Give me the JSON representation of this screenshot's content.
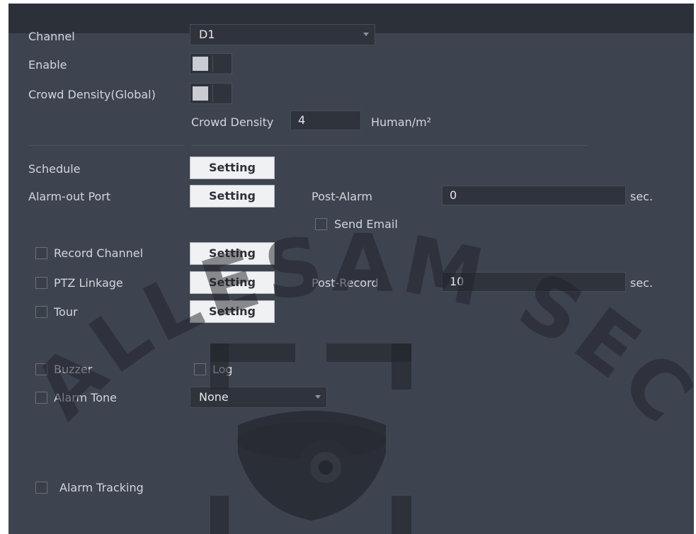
{
  "channel": {
    "label": "Channel",
    "value": "D1"
  },
  "enable": {
    "label": "Enable",
    "on": true
  },
  "crowd_global": {
    "label": "Crowd Density(Global)",
    "on": true
  },
  "crowd_density": {
    "label": "Crowd Density",
    "value": "4",
    "unit": "Human/m²"
  },
  "schedule": {
    "label": "Schedule",
    "button": "Setting"
  },
  "alarm_out": {
    "label": "Alarm-out Port",
    "button": "Setting"
  },
  "post_alarm": {
    "label": "Post-Alarm",
    "value": "0",
    "unit": "sec."
  },
  "send_email": {
    "label": "Send Email",
    "checked": false
  },
  "record_channel": {
    "label": "Record Channel",
    "button": "Setting",
    "checked": false
  },
  "ptz_linkage": {
    "label": "PTZ Linkage",
    "button": "Setting",
    "checked": false
  },
  "post_record": {
    "label": "Post-Record",
    "value": "10",
    "unit": "sec."
  },
  "tour": {
    "label": "Tour",
    "button": "Setting",
    "checked": false
  },
  "buzzer": {
    "label": "Buzzer",
    "checked": false
  },
  "log": {
    "label": "Log",
    "checked": false
  },
  "alarm_tone": {
    "label": "Alarm Tone",
    "value": "None",
    "checked": false
  },
  "alarm_tracking": {
    "label": "Alarm Tracking",
    "checked": false
  },
  "watermark": {
    "text": "ALLESAM SECURITY"
  },
  "colors": {
    "panel": "#3e4350",
    "topbar": "#2c3039",
    "button_bg": "#f0f1f2"
  }
}
